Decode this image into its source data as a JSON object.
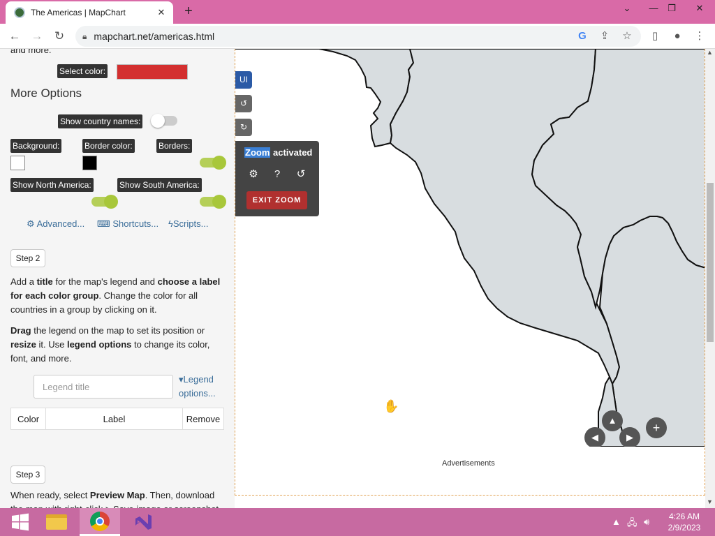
{
  "browser": {
    "tab_title": "The Americas | MapChart",
    "url": "mapchart.net/americas.html"
  },
  "sidebar": {
    "partial_text": "and more.",
    "select_color_label": "Select color:",
    "select_color_value": "#d32f2f",
    "more_options_title": "More Options",
    "show_country_names_label": "Show country names:",
    "background_label": "Background:",
    "border_color_label": "Border color:",
    "borders_label": "Borders:",
    "background_color": "#ffffff",
    "border_color": "#000000",
    "show_north_america_label": "Show North America:",
    "show_south_america_label": "Show South America:",
    "toggles": {
      "show_country_names": false,
      "borders": true,
      "show_north_america": true,
      "show_south_america": true
    },
    "advanced_link": "Advanced...",
    "shortcuts_link": "Shortcuts...",
    "scripts_link": "Scripts...",
    "step2": "Step 2",
    "step2_p1": [
      "Add a ",
      "title",
      " for the map's legend and ",
      "choose a label for each color group",
      ". Change the color for all countries in a group by clicking on it."
    ],
    "step2_p2": [
      "Drag",
      " the legend on the map to set its position or ",
      "resize",
      " it. Use ",
      "legend options",
      " to change its color, font, and more."
    ],
    "legend_title_placeholder": "Legend title",
    "legend_options_link": "Legend options...",
    "table_headers": [
      "Color",
      "Label",
      "Remove"
    ],
    "step3": "Step 3",
    "step3_p1": [
      "When ready, select ",
      "Preview Map",
      ". Then, download"
    ],
    "step3_p2": "the map with right-click > Save image or screenshot"
  },
  "map": {
    "ui_button": "UI",
    "zoom_word": "Zoom",
    "activated_word": " activated",
    "exit_zoom": "EXIT ZOOM",
    "advertisements": "Advertisements",
    "icons": [
      "undo-icon",
      "redo-icon",
      "gear-icon",
      "help-icon",
      "history-icon",
      "arrow-up-icon",
      "arrow-left-icon",
      "arrow-right-icon",
      "zoom-in-icon"
    ]
  },
  "taskbar": {
    "time": "4:26 AM",
    "date": "2/9/2023"
  },
  "colors": {
    "titlebar": "#d96aa7",
    "taskbar": "#c76aa1",
    "toggle_on": "#b5cf58",
    "map_land": "#d8dde0",
    "exit_zoom": "#b1302f"
  }
}
